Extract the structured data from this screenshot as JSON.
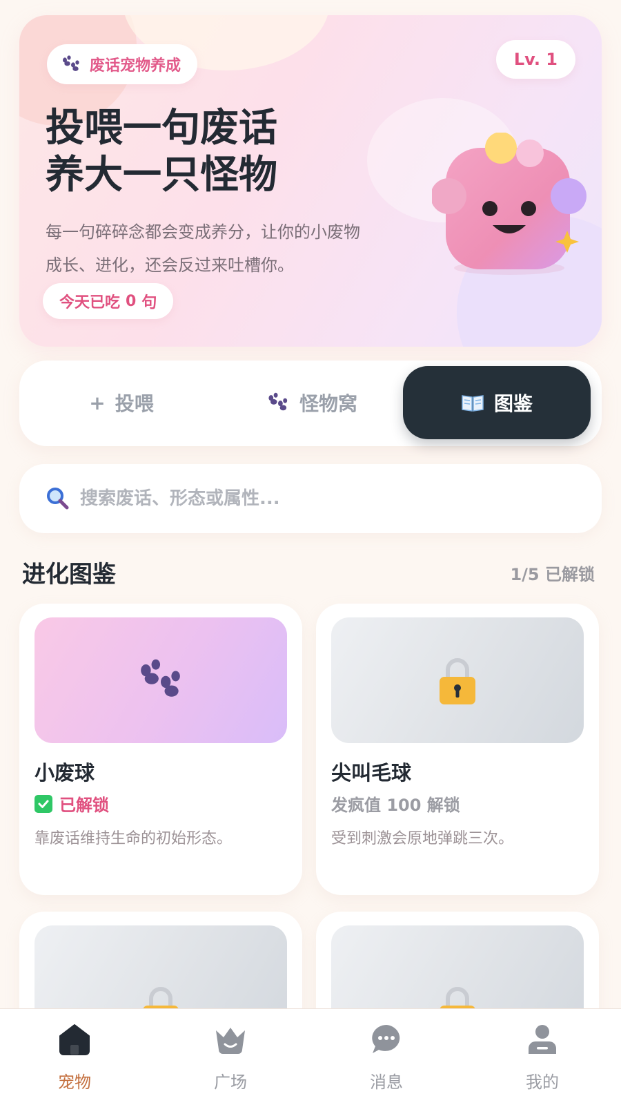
{
  "hero": {
    "brand_label": "废话宠物养成",
    "level_label": "Lv. 1",
    "title_line1": "投喂一句废话",
    "title_line2": "养大一只怪物",
    "desc_line1": "每一句碎碎念都会变成养分，让你的小废物",
    "desc_line2": "成长、进化，还会反过来吐槽你。",
    "count_prefix": "今天已吃",
    "count_value": "0",
    "count_suffix": "句"
  },
  "tabs": [
    {
      "label": "投喂",
      "icon": "plus-icon",
      "active": false
    },
    {
      "label": "怪物窝",
      "icon": "paw-icon",
      "active": false
    },
    {
      "label": "图鉴",
      "icon": "book-icon",
      "active": true
    }
  ],
  "search": {
    "placeholder": "搜索废话、形态或属性...",
    "value": ""
  },
  "section": {
    "title": "进化图鉴",
    "meta": "1/5 已解锁"
  },
  "cards": [
    {
      "name": "小废球",
      "status": "已解锁",
      "unlocked": true,
      "desc": "靠废话维持生命的初始形态。",
      "icon": "paw-icon"
    },
    {
      "name": "尖叫毛球",
      "status": "发疯值 100 解锁",
      "unlocked": false,
      "desc": "受到刺激会原地弹跳三次。",
      "icon": "lock-icon"
    },
    {
      "name": "",
      "status": "",
      "unlocked": false,
      "desc": "",
      "icon": "lock-icon"
    },
    {
      "name": "",
      "status": "",
      "unlocked": false,
      "desc": "",
      "icon": "lock-icon"
    }
  ],
  "bottom_nav": [
    {
      "label": "宠物",
      "icon": "home-icon",
      "active": true
    },
    {
      "label": "广场",
      "icon": "crown-icon",
      "active": false
    },
    {
      "label": "消息",
      "icon": "chat-icon",
      "active": false
    },
    {
      "label": "我的",
      "icon": "user-icon",
      "active": false
    }
  ],
  "colors": {
    "accent_pink": "#e0507f",
    "dark": "#253039",
    "nav_active": "#c4703f",
    "paw_purple": "#5a4a8a",
    "lock_yellow": "#f5b83a"
  }
}
